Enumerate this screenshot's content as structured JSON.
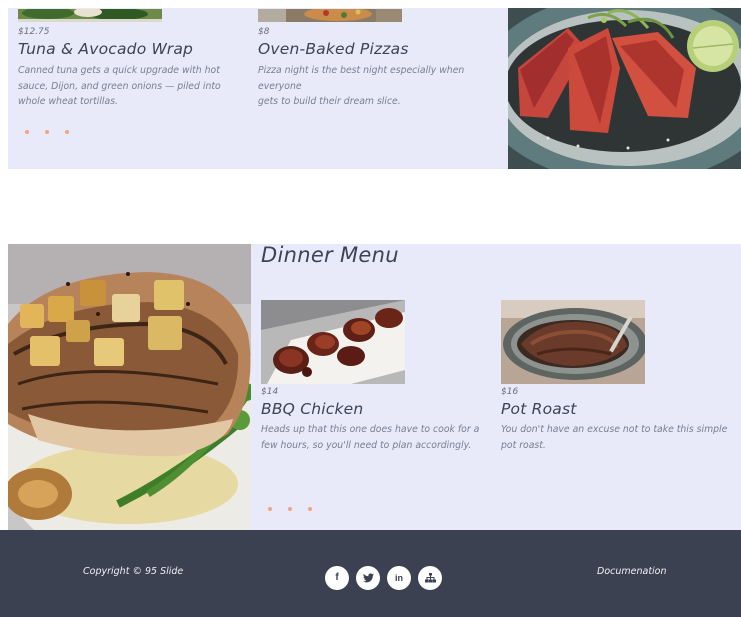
{
  "lunch": {
    "items": [
      {
        "price": "$12.75",
        "title": "Tuna & Avocado Wrap",
        "description": "Canned tuna gets a quick upgrade with hot sauce, Dijon, and green onions — piled into whole wheat tortillas."
      },
      {
        "price": "$8",
        "title": "Oven-Baked Pizzas",
        "description_line1": "Pizza night is the best night especially when everyone",
        "description_line2": "gets to build their dream slice."
      }
    ]
  },
  "dinner": {
    "heading": "Dinner Menu",
    "items": [
      {
        "price": "$14",
        "title": "BBQ Chicken",
        "description": "Heads up that this one does have to cook for a few hours, so you'll need to plan accordingly."
      },
      {
        "price": "$16",
        "title": "Pot Roast",
        "description": "You don't have an excuse not to take this simple pot roast."
      }
    ]
  },
  "footer": {
    "copyright": "Copyright © 95 Slide",
    "documentation": "Documenation",
    "social_icons": [
      "facebook-icon",
      "twitter-icon",
      "linkedin-icon",
      "sitemap-icon"
    ]
  },
  "colors": {
    "band_background": "#e8eafa",
    "footer_background": "#3b4150",
    "accent_dot": "#f2a57f",
    "heading_text": "#3e4256"
  }
}
